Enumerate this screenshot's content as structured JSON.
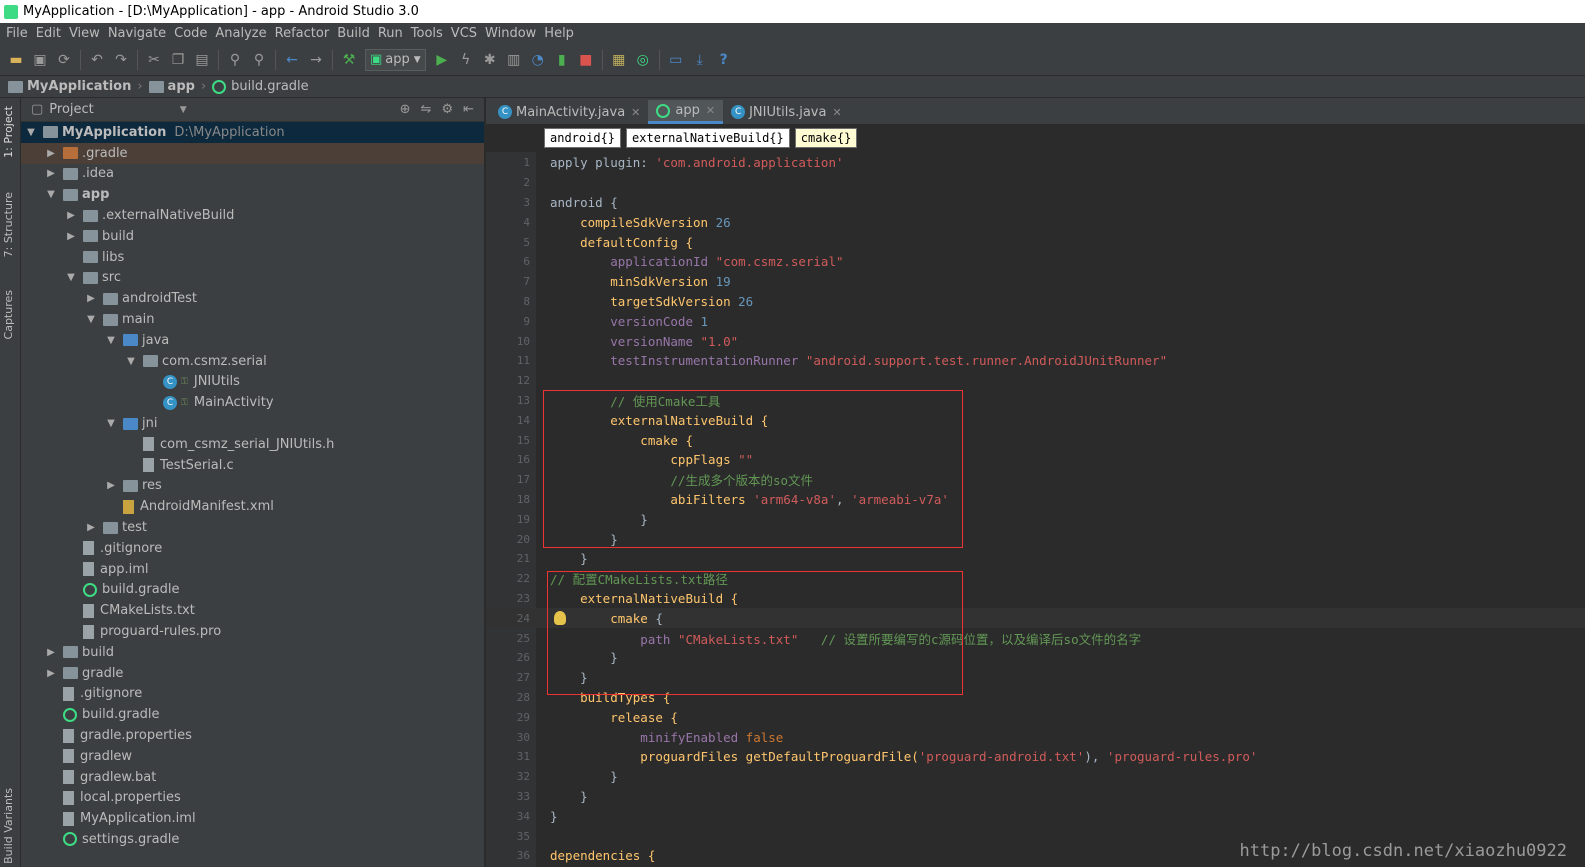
{
  "window": {
    "title": "MyApplication - [D:\\MyApplication] - app - Android Studio 3.0"
  },
  "menu": [
    "File",
    "Edit",
    "View",
    "Navigate",
    "Code",
    "Analyze",
    "Refactor",
    "Build",
    "Run",
    "Tools",
    "VCS",
    "Window",
    "Help"
  ],
  "toolbar": {
    "run_config": "app"
  },
  "nav": {
    "project": "MyApplication",
    "module": "app",
    "file": "build.gradle"
  },
  "left_tabs": {
    "project": "1: Project",
    "structure": "7: Structure",
    "captures": "Captures",
    "build_variants": "Build Variants"
  },
  "project_panel": {
    "header": "Project"
  },
  "tree": [
    {
      "label": "MyApplication",
      "path": "D:\\MyApplication"
    },
    {
      "label": ".gradle"
    },
    {
      "label": ".idea"
    },
    {
      "label": "app"
    },
    {
      "label": ".externalNativeBuild"
    },
    {
      "label": "build"
    },
    {
      "label": "libs"
    },
    {
      "label": "src"
    },
    {
      "label": "androidTest"
    },
    {
      "label": "main"
    },
    {
      "label": "java"
    },
    {
      "label": "com.csmz.serial"
    },
    {
      "label": "JNIUtils"
    },
    {
      "label": "MainActivity"
    },
    {
      "label": "jni"
    },
    {
      "label": "com_csmz_serial_JNIUtils.h"
    },
    {
      "label": "TestSerial.c"
    },
    {
      "label": "res"
    },
    {
      "label": "AndroidManifest.xml"
    },
    {
      "label": "test"
    },
    {
      "label": ".gitignore"
    },
    {
      "label": "app.iml"
    },
    {
      "label": "build.gradle"
    },
    {
      "label": "CMakeLists.txt"
    },
    {
      "label": "proguard-rules.pro"
    },
    {
      "label": "build"
    },
    {
      "label": "gradle"
    },
    {
      "label": ".gitignore"
    },
    {
      "label": "build.gradle"
    },
    {
      "label": "gradle.properties"
    },
    {
      "label": "gradlew"
    },
    {
      "label": "gradlew.bat"
    },
    {
      "label": "local.properties"
    },
    {
      "label": "MyApplication.iml"
    },
    {
      "label": "settings.gradle"
    }
  ],
  "tabs": [
    "MainActivity.java",
    "app",
    "JNIUtils.java"
  ],
  "editor_crumbs": [
    "android{}",
    "externalNativeBuild{}",
    "cmake{}"
  ],
  "code": {
    "l1a": "apply plugin: ",
    "l1b": "'com.android.application'",
    "l3": "android {",
    "l4a": "    compileSdkVersion ",
    "l4b": "26",
    "l5": "    defaultConfig {",
    "l6a": "        applicationId ",
    "l6b": "\"com.csmz.serial\"",
    "l7a": "        minSdkVersion ",
    "l7b": "19",
    "l8a": "        targetSdkVersion ",
    "l8b": "26",
    "l9a": "        versionCode ",
    "l9b": "1",
    "l10a": "        versionName ",
    "l10b": "\"1.0\"",
    "l11a": "        testInstrumentationRunner ",
    "l11b": "\"android.support.test.runner.AndroidJUnitRunner\"",
    "l13": "        // 使用Cmake工具",
    "l14": "        externalNativeBuild {",
    "l15": "            cmake {",
    "l16a": "                cppFlags ",
    "l16b": "\"\"",
    "l17": "                //生成多个版本的so文件",
    "l18a": "                abiFilters ",
    "l18b": "'arm64-v8a'",
    "l18c": ", ",
    "l18d": "'armeabi-v7a'",
    "l19": "            }",
    "l20": "        }",
    "l21": "    }",
    "l22": "// 配置CMakeLists.txt路径",
    "l23": "    externalNativeBuild {",
    "l24a": "        cmake ",
    "l24b": "{",
    "l25a": "            path ",
    "l25b": "\"CMakeLists.txt\"",
    "l25c": "   // 设置所要编写的c源码位置，以及编译后so文件的名字",
    "l26": "        }",
    "l27": "    }",
    "l28": "    buildTypes {",
    "l29": "        release {",
    "l30a": "            minifyEnabled ",
    "l30b": "false",
    "l31a": "            proguardFiles getDefaultProguardFile(",
    "l31b": "'proguard-android.txt'",
    "l31c": "), ",
    "l31d": "'proguard-rules.pro'",
    "l32": "        }",
    "l33": "    }",
    "l34": "}",
    "l36": "dependencies {"
  },
  "watermark": "http://blog.csdn.net/xiaozhu0922"
}
